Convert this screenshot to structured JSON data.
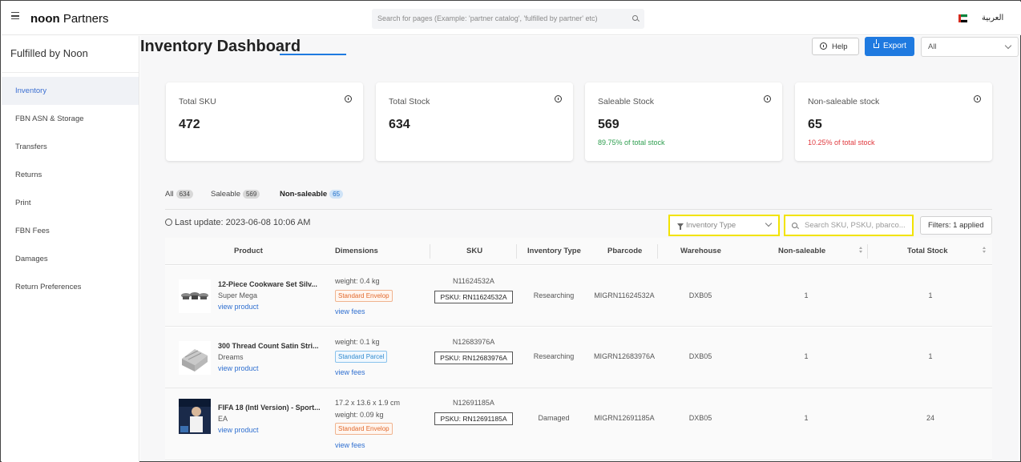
{
  "topbar": {
    "brand_bold": "noon",
    "brand_light": " Partners",
    "search_placeholder": "Search for pages (Example: 'partner catalog', 'fulfilled by partner' etc)",
    "language": "العربية",
    "flag_colors": [
      "#d52b1e",
      "#00843d",
      "#ffffff",
      "#000000"
    ]
  },
  "sidebar": {
    "title": "Fulfilled by Noon",
    "items": [
      {
        "label": "Inventory",
        "active": true
      },
      {
        "label": "FBN ASN & Storage"
      },
      {
        "label": "Transfers"
      },
      {
        "label": "Returns"
      },
      {
        "label": "Print"
      },
      {
        "label": "FBN Fees"
      },
      {
        "label": "Damages"
      },
      {
        "label": "Return Preferences"
      }
    ]
  },
  "header": {
    "title": "Inventory Dashboard",
    "help_label": "Help",
    "export_label": "Export",
    "select_value": "All"
  },
  "cards": [
    {
      "label": "Total SKU",
      "value": "472",
      "sub": ""
    },
    {
      "label": "Total Stock",
      "value": "634",
      "sub": ""
    },
    {
      "label": "Saleable Stock",
      "value": "569",
      "sub": "89.75% of total stock",
      "sub_color": "#2e9e4f"
    },
    {
      "label": "Non-saleable stock",
      "value": "65",
      "sub": "10.25% of total stock",
      "sub_color": "#e0393e"
    }
  ],
  "tabs": [
    {
      "label": "All",
      "count": "634"
    },
    {
      "label": "Saleable",
      "count": "569"
    },
    {
      "label": "Non-saleable",
      "count": "65",
      "active": true
    }
  ],
  "last_update": "Last update: 2023-06-08 10:06 AM",
  "filters": {
    "inventory_type_placeholder": "Inventory Type",
    "search_placeholder": "Search SKU, PSKU, pbarco...",
    "filters_label": "Filters:",
    "filters_applied": "1 applied"
  },
  "table": {
    "columns": [
      "Product",
      "Dimensions",
      "SKU",
      "Inventory Type",
      "Pbarcode",
      "Warehouse",
      "Non-saleable",
      "Total Stock"
    ],
    "view_product_label": "view product",
    "view_fees_label": "view fees",
    "rows": [
      {
        "name": "12-Piece Cookware Set Silv...",
        "brand": "Super Mega",
        "dims": [
          "weight: 0.4 kg"
        ],
        "badge": "Standard Envelop",
        "badge_type": "env",
        "sku": "N11624532A",
        "psku": "PSKU: RN11624532A",
        "inventory_type": "Researching",
        "pbarcode": "MIGRN11624532A",
        "warehouse": "DXB05",
        "non_saleable": "1",
        "total_stock": "1"
      },
      {
        "name": "300 Thread Count Satin Stri...",
        "brand": "Dreams",
        "dims": [
          "weight: 0.1 kg"
        ],
        "badge": "Standard Parcel",
        "badge_type": "par",
        "sku": "N12683976A",
        "psku": "PSKU: RN12683976A",
        "inventory_type": "Researching",
        "pbarcode": "MIGRN12683976A",
        "warehouse": "DXB05",
        "non_saleable": "1",
        "total_stock": "1"
      },
      {
        "name": "FIFA 18 (Intl Version) - Sport...",
        "brand": "EA",
        "dims": [
          "17.2 x 13.6 x 1.9 cm",
          "weight: 0.09 kg"
        ],
        "badge": "Standard Envelop",
        "badge_type": "env",
        "sku": "N12691185A",
        "psku": "PSKU: RN12691185A",
        "inventory_type": "Damaged",
        "pbarcode": "MIGRN12691185A",
        "warehouse": "DXB05",
        "non_saleable": "1",
        "total_stock": "24"
      }
    ]
  }
}
